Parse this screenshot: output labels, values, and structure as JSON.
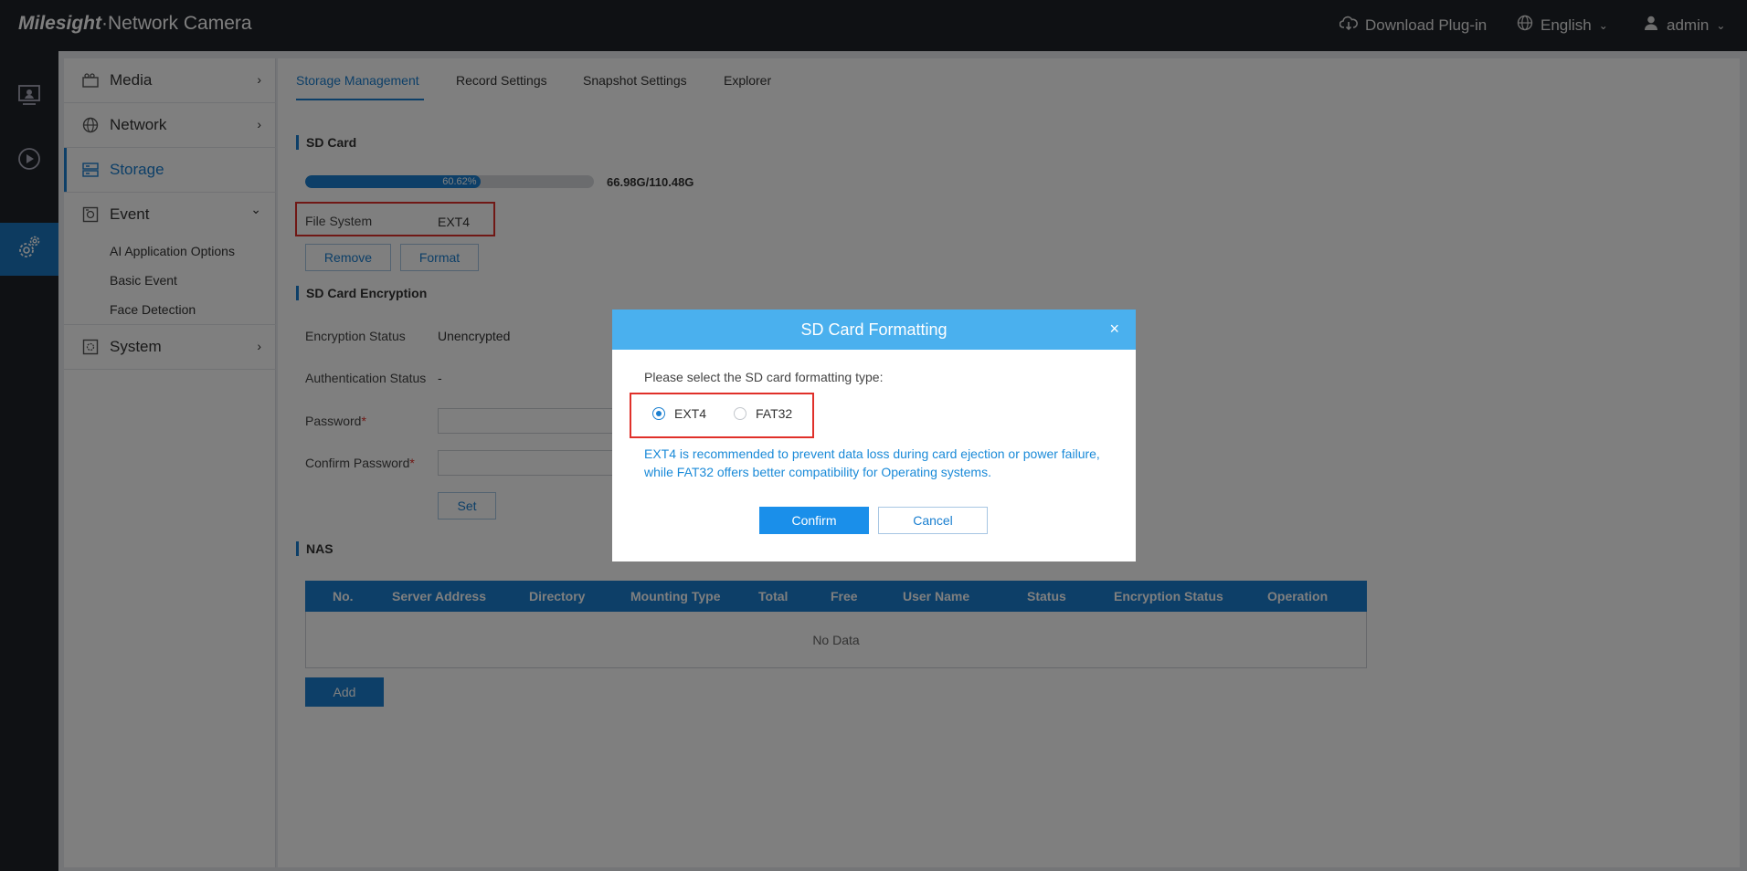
{
  "header": {
    "logo_brand": "Milesight",
    "logo_product": "·Network Camera",
    "download_plugin": "Download Plug-in",
    "language": "English",
    "user": "admin"
  },
  "leftnav": {
    "items": [
      "live-view-icon",
      "playback-icon",
      "settings-icon"
    ],
    "active": "settings-icon"
  },
  "sidebar": {
    "media": "Media",
    "network": "Network",
    "storage": "Storage",
    "event": "Event",
    "event_subitems": [
      "AI Application Options",
      "Basic Event",
      "Face Detection"
    ],
    "system": "System",
    "arrow_right": "›",
    "arrow_down": "⌄"
  },
  "tabs": [
    "Storage Management",
    "Record Settings",
    "Snapshot Settings",
    "Explorer"
  ],
  "sd_card": {
    "title": "SD Card",
    "used_percent": 60.62,
    "used_percent_label": "60.62%",
    "capacity": "66.98G/110.48G",
    "file_system_label": "File System",
    "file_system_value": "EXT4",
    "remove_btn": "Remove",
    "format_btn": "Format"
  },
  "encryption": {
    "title": "SD Card Encryption",
    "status_label": "Encryption Status",
    "status_value": "Unencrypted",
    "auth_label": "Authentication Status",
    "auth_value": "-",
    "password_label": "Password",
    "confirm_label": "Confirm Password",
    "required_mark": "*",
    "set_btn": "Set"
  },
  "nas": {
    "title": "NAS",
    "columns": [
      "No.",
      "Server Address",
      "Directory",
      "Mounting Type",
      "Total",
      "Free",
      "User Name",
      "Status",
      "Encryption Status",
      "Operation"
    ],
    "empty_text": "No Data",
    "add_btn": "Add"
  },
  "modal": {
    "title": "SD Card Formatting",
    "close": "×",
    "prompt": "Please select the SD card formatting type:",
    "options": [
      "EXT4",
      "FAT32"
    ],
    "selected": "EXT4",
    "hint": "EXT4 is recommended to prevent data loss during card ejection or power failure, while FAT32 offers better compatibility for Operating systems.",
    "confirm_btn": "Confirm",
    "cancel_btn": "Cancel"
  },
  "colors": {
    "accent": "#1a7fd0",
    "modal_header": "#4ab0ee",
    "highlight": "#e0302a",
    "topbar": "#1f2228"
  }
}
